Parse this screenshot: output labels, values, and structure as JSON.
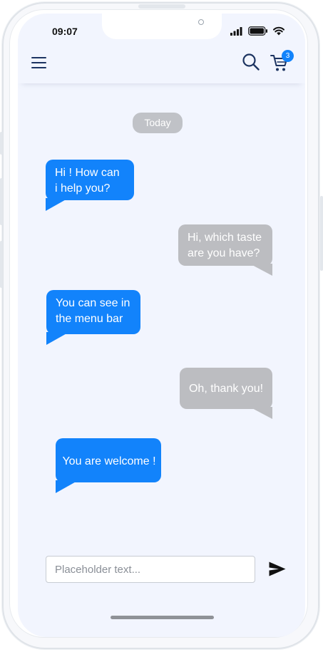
{
  "status_bar": {
    "time": "09:07",
    "icons": [
      "signal-icon",
      "battery-icon",
      "wifi-icon"
    ]
  },
  "header": {
    "menu_icon": "hamburger-menu-icon",
    "search_icon": "search-icon",
    "cart_icon": "shopping-cart-icon",
    "cart_badge": "3"
  },
  "chat": {
    "date_separator": "Today",
    "messages": [
      {
        "sender": "agent",
        "text": "Hi ! How can\ni help you?"
      },
      {
        "sender": "user",
        "text": "Hi, which taste\nare you  have?"
      },
      {
        "sender": "agent",
        "text": "You can see in\nthe menu bar"
      },
      {
        "sender": "user",
        "text": "Oh, thank you!"
      },
      {
        "sender": "agent",
        "text": "You are welcome !"
      }
    ]
  },
  "composer": {
    "placeholder": "Placeholder text...",
    "value": "",
    "send_icon": "send-icon"
  },
  "colors": {
    "accent": "#1283fb",
    "incoming_bubble": "#1283fb",
    "outgoing_bubble": "#bcbdc1",
    "screen_bg": "#f2f5fe",
    "header_icon": "#1d3461"
  }
}
